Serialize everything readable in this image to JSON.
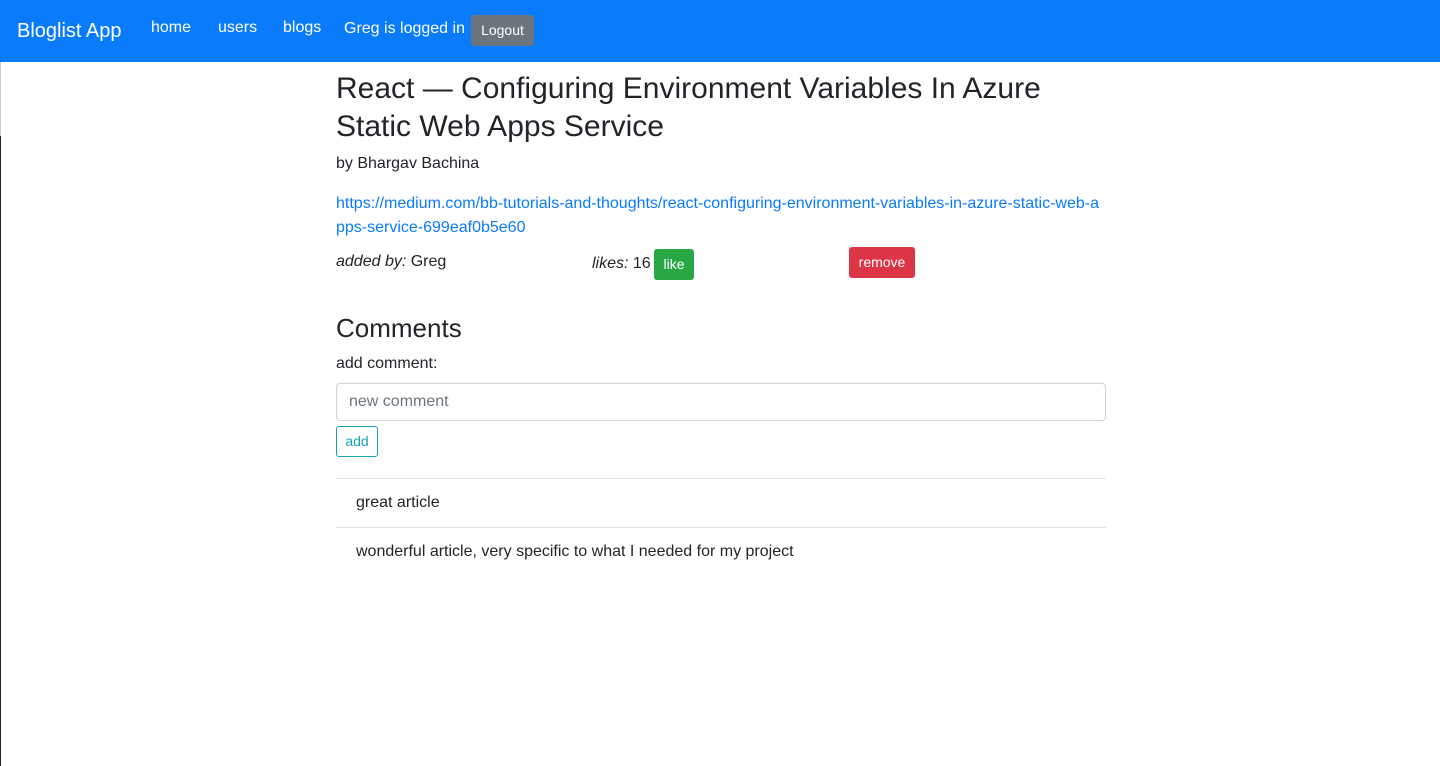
{
  "navbar": {
    "brand": "Bloglist App",
    "links": [
      "home",
      "users",
      "blogs"
    ],
    "logged_in_text": "Greg is logged in",
    "logout_label": "Logout",
    "background_color": "#0a7bfb"
  },
  "blog": {
    "title": "React — Configuring Environment Variables In Azure Static Web Apps Service",
    "author_line": "by Bhargav Bachina",
    "url": "https://medium.com/bb-tutorials-and-thoughts/react-configuring-environment-variables-in-azure-static-web-apps-service-699eaf0b5e60",
    "added_by_label": "added by:",
    "added_by_user": "Greg",
    "likes_label": "likes:",
    "likes_count": "16",
    "like_button": "like",
    "remove_button": "remove"
  },
  "comments": {
    "heading": "Comments",
    "add_label": "add comment:",
    "input_placeholder": "new comment",
    "input_value": "",
    "add_button": "add",
    "items": [
      "great article",
      "wonderful article, very specific to what I needed for my project"
    ]
  },
  "colors": {
    "primary": "#0a7bfb",
    "success": "#28a745",
    "danger": "#dc3545",
    "info": "#17a2b8",
    "secondary": "#6c757d"
  }
}
